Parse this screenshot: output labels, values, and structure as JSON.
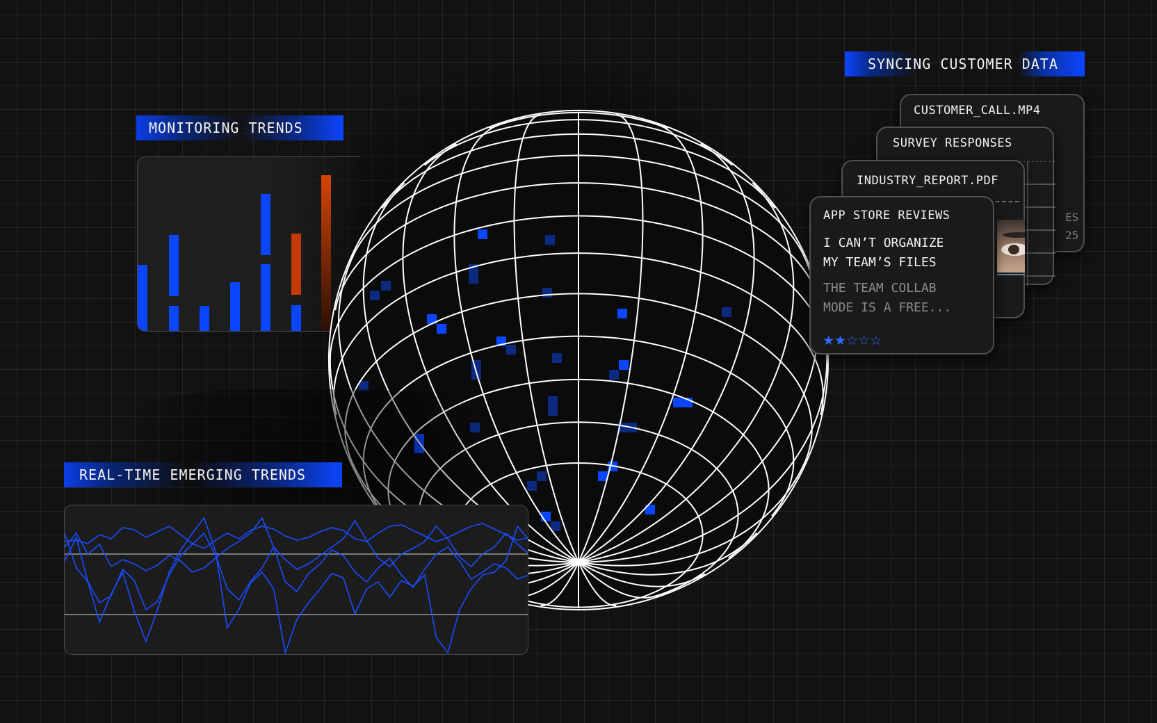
{
  "monitoring": {
    "label": "MONITORING TRENDS",
    "colors": {
      "blue": "#0a46ff",
      "orange": "#c23a06"
    }
  },
  "emerging": {
    "label": "REAL-TIME EMERGING TRENDS",
    "line_color": "#1a4dff"
  },
  "syncing": {
    "label": "SYNCING CUSTOMER DATA"
  },
  "cards": {
    "customer_call": {
      "title": "CUSTOMER_CALL.MP4",
      "partial_line1": "ES",
      "partial_line2": "25"
    },
    "survey": {
      "title": "SURVEY RESPONSES"
    },
    "industry": {
      "title": "INDUSTRY_REPORT.PDF"
    },
    "app_store": {
      "title": "APP STORE REVIEWS",
      "headline_line1": "I CAN’T ORGANIZE",
      "headline_line2": "MY TEAM’S FILES",
      "body_line1": "THE TEAM COLLAB",
      "body_line2": "MODE IS A FREE...",
      "rating": 2,
      "rating_max": 5,
      "star_color": "#2d6bff"
    }
  },
  "accent": "#0a46ff"
}
